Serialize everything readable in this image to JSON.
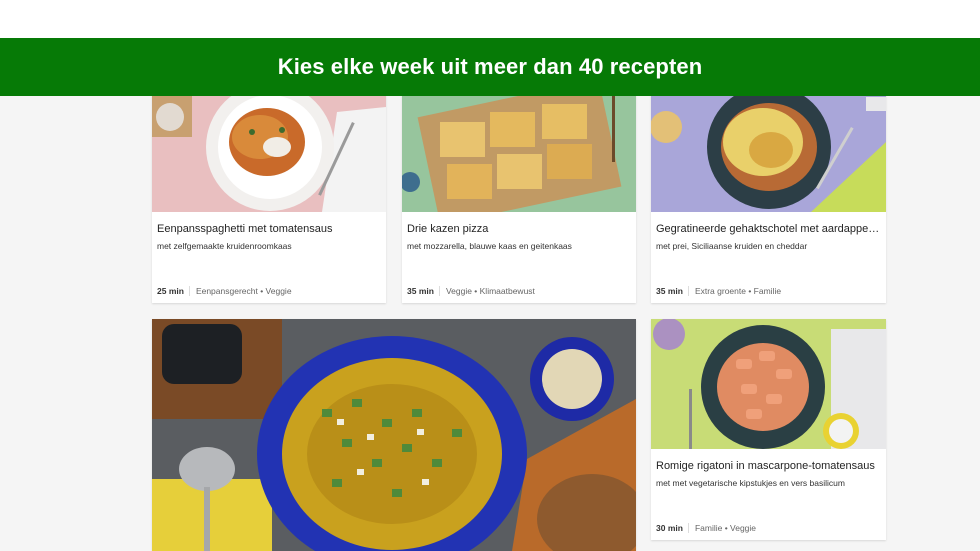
{
  "banner": {
    "title": "Kies elke week uit meer dan 40 recepten"
  },
  "recipes": [
    {
      "title": "Eenpansspaghetti met tomatensaus",
      "subtitle": "met zelfgemaakte kruidenroomkaas",
      "time": "25 min",
      "tags": "Eenpansgerecht • Veggie"
    },
    {
      "title": "Drie kazen pizza",
      "subtitle": "met mozzarella, blauwe kaas en geitenkaas",
      "time": "35 min",
      "tags": "Veggie • Klimaatbewust"
    },
    {
      "title": "Gegratineerde gehaktschotel met aardappelen",
      "subtitle": "met prei, Siciliaanse kruiden en cheddar",
      "time": "35 min",
      "tags": "Extra groente • Familie"
    },
    {
      "title": "Romige rigatoni in mascarpone-tomatensaus",
      "subtitle": "met met vegetarische kipstukjes en vers basilicum",
      "time": "30 min",
      "tags": "Familie • Veggie"
    }
  ]
}
